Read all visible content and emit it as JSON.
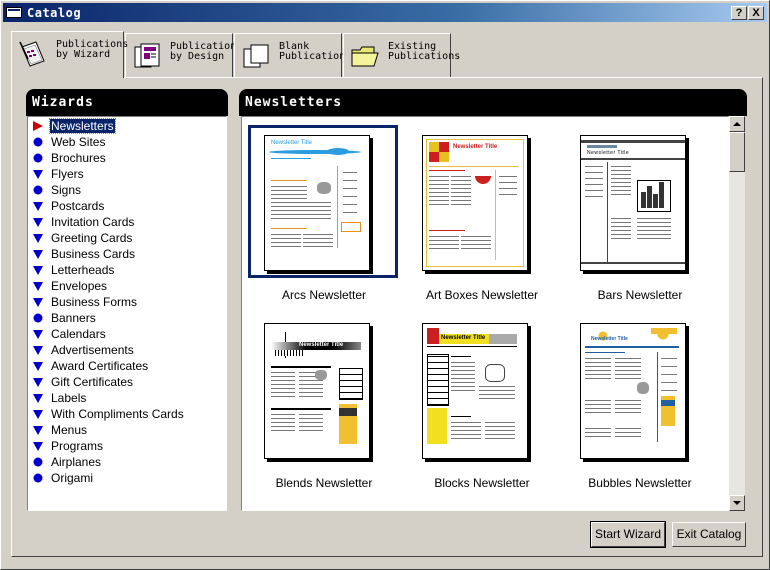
{
  "window": {
    "title": "Catalog",
    "help_button": "?",
    "close_button": "X"
  },
  "tabs": [
    {
      "line1": "Publications",
      "line2": "by Wizard",
      "icon": "wizard-book-icon",
      "active": true
    },
    {
      "line1": "Publications",
      "line2": "by Design",
      "icon": "design-pages-icon",
      "active": false
    },
    {
      "line1": "Blank",
      "line2": "Publications",
      "icon": "blank-pages-icon",
      "active": false
    },
    {
      "line1": "Existing",
      "line2": "Publications",
      "icon": "folder-icon",
      "active": false
    }
  ],
  "wizards": {
    "header": "Wizards",
    "items": [
      "Newsletters",
      "Web Sites",
      "Brochures",
      "Flyers",
      "Signs",
      "Postcards",
      "Invitation Cards",
      "Greeting Cards",
      "Business Cards",
      "Letterheads",
      "Envelopes",
      "Business Forms",
      "Banners",
      "Calendars",
      "Advertisements",
      "Award Certificates",
      "Gift Certificates",
      "Labels",
      "With Compliments Cards",
      "Menus",
      "Programs",
      "Airplanes",
      "Origami"
    ],
    "bullets": [
      "arrow-red",
      "circle",
      "circle",
      "triangle",
      "circle",
      "triangle",
      "triangle",
      "triangle",
      "triangle",
      "triangle",
      "triangle",
      "triangle",
      "circle",
      "triangle",
      "triangle",
      "triangle",
      "triangle",
      "triangle",
      "triangle",
      "triangle",
      "triangle",
      "circle",
      "circle"
    ],
    "selected_index": 0
  },
  "gallery": {
    "header": "Newsletters",
    "items": [
      {
        "caption": "Arcs Newsletter",
        "selected": true,
        "thumb_title": "Newsletter Title"
      },
      {
        "caption": "Art Boxes Newsletter",
        "selected": false,
        "thumb_title": "Newsletter Title"
      },
      {
        "caption": "Bars Newsletter",
        "selected": false,
        "thumb_title": "Newsletter Title"
      },
      {
        "caption": "Blends Newsletter",
        "selected": false,
        "thumb_title": "Newsletter Title"
      },
      {
        "caption": "Blocks Newsletter",
        "selected": false,
        "thumb_title": "Newsletter Title"
      },
      {
        "caption": "Bubbles Newsletter",
        "selected": false,
        "thumb_title": "Newsletter Title"
      }
    ]
  },
  "buttons": {
    "start": "Start Wizard",
    "exit": "Exit Catalog"
  },
  "colors": {
    "title_bar": "#0a246a",
    "selection": "#0a246a",
    "bullet_blue": "#0000cc",
    "bullet_red": "#cc0000"
  }
}
